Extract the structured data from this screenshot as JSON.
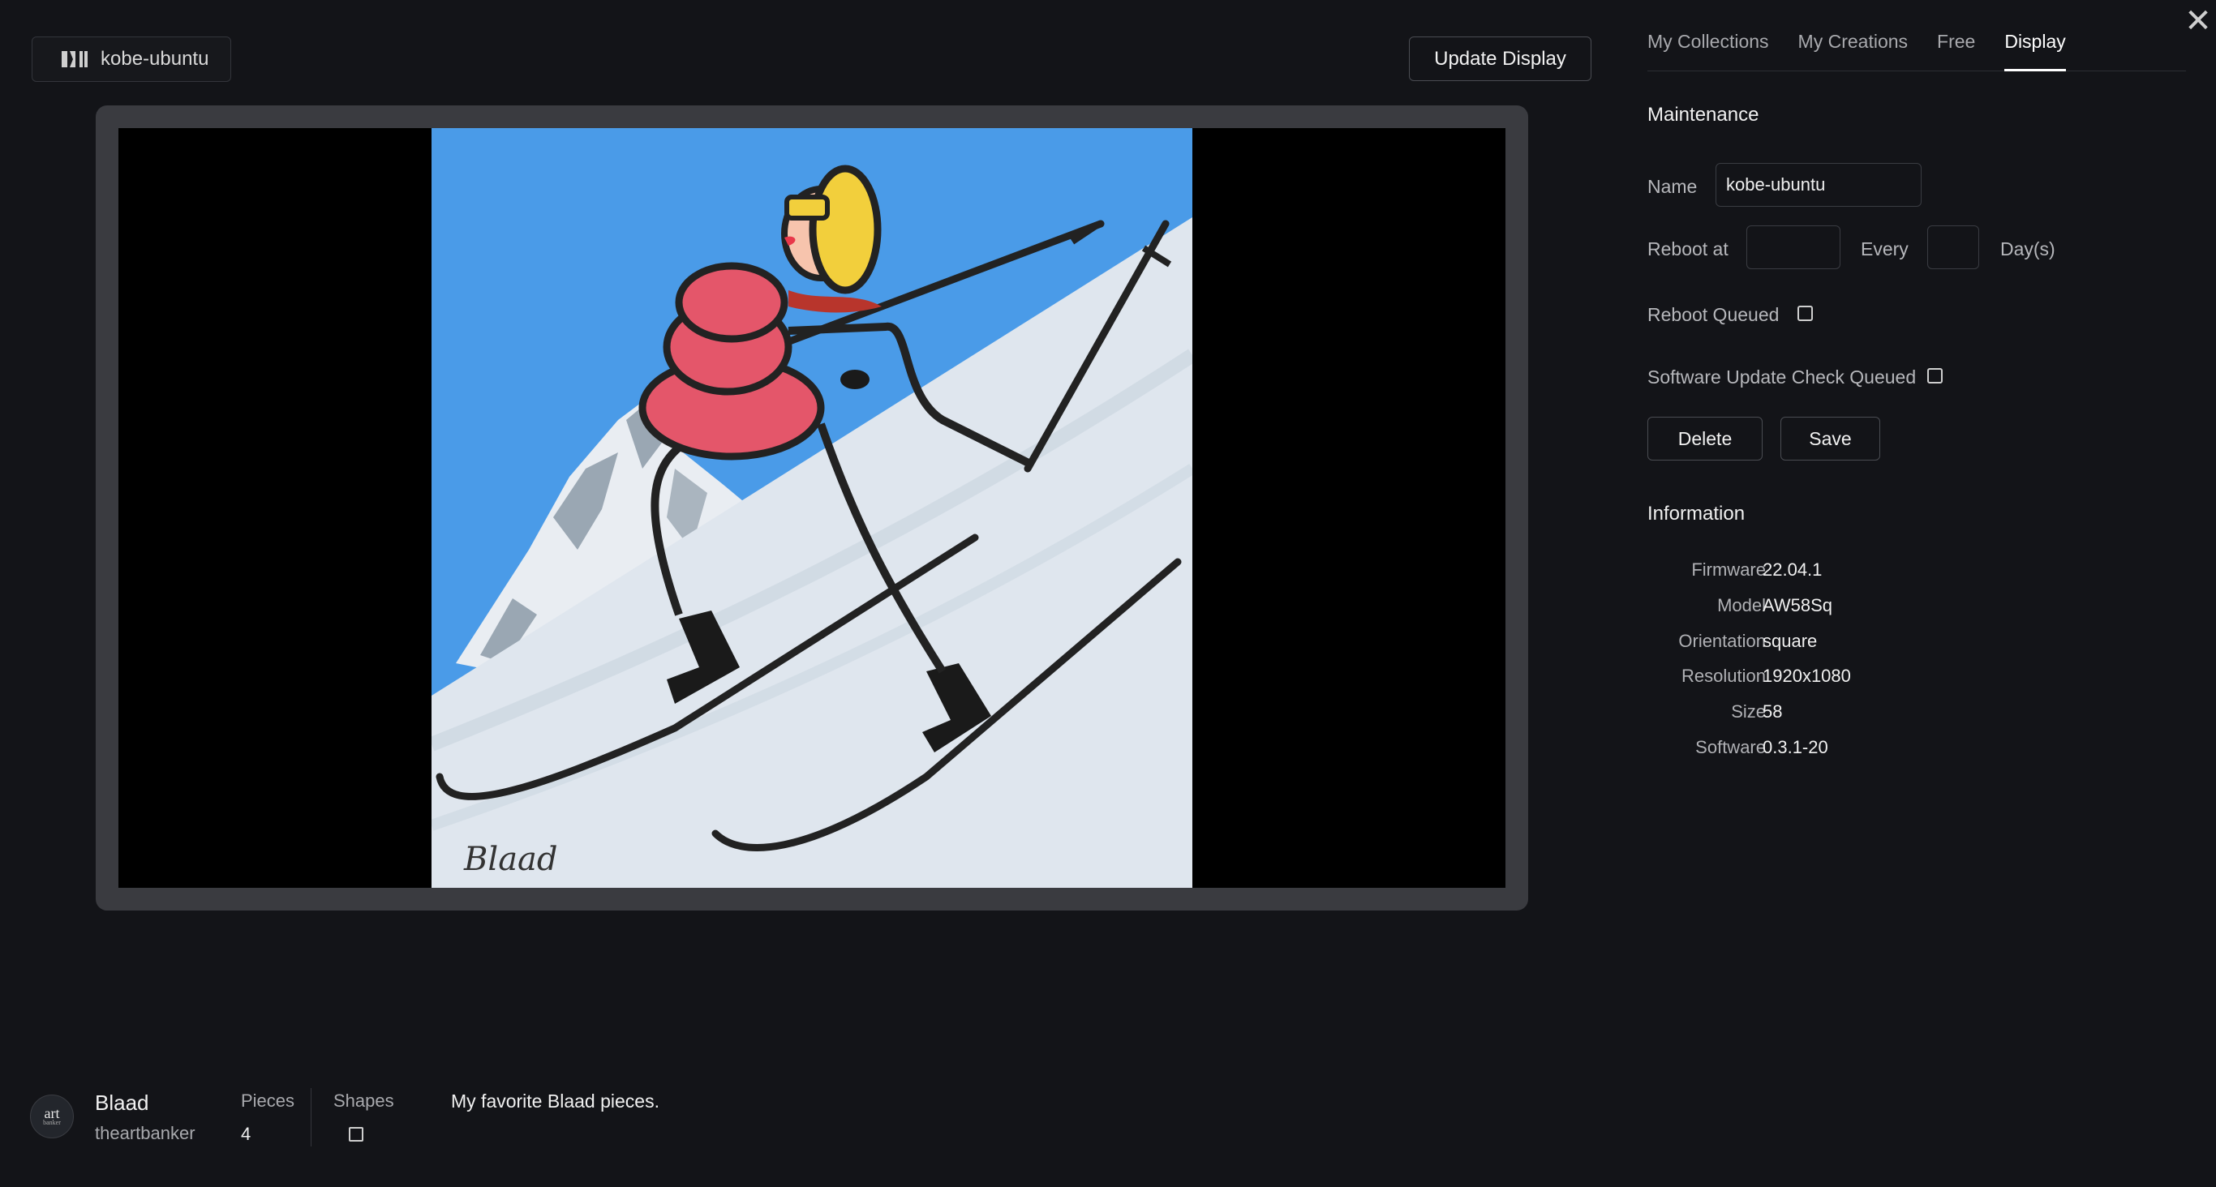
{
  "device": {
    "name": "kobe-ubuntu",
    "icon": "display-brand-icon"
  },
  "header": {
    "update_label": "Update Display",
    "close_icon": "close-icon",
    "close_glyph": "✕"
  },
  "tabs": [
    {
      "label": "My Collections",
      "active": false
    },
    {
      "label": "My Creations",
      "active": false
    },
    {
      "label": "Free",
      "active": false
    },
    {
      "label": "Display",
      "active": true
    }
  ],
  "maintenance": {
    "title": "Maintenance",
    "name_label": "Name",
    "name_value": "kobe-ubuntu",
    "reboot_at_label": "Reboot at",
    "reboot_at_value": "",
    "every_label": "Every",
    "every_value": "",
    "days_label": "Day(s)",
    "reboot_queued_label": "Reboot Queued",
    "reboot_queued_checked": false,
    "software_update_label": "Software Update Check Queued",
    "software_update_checked": false,
    "delete_label": "Delete",
    "save_label": "Save"
  },
  "information": {
    "title": "Information",
    "rows": [
      {
        "key": "Firmware",
        "value": "22.04.1"
      },
      {
        "key": "Model",
        "value": "AW58Sq"
      },
      {
        "key": "Orientation",
        "value": "square"
      },
      {
        "key": "Resolution",
        "value": "1920x1080"
      },
      {
        "key": "Size",
        "value": "58"
      },
      {
        "key": "Software",
        "value": "0.3.1-20"
      }
    ]
  },
  "artwork": {
    "signature": "Blaad",
    "colors": {
      "sky": "#4a9be8",
      "snow": "#dfe6ee",
      "jacket": "#e4566a",
      "hair": "#f2cf3c",
      "scarf": "#b8352c"
    }
  },
  "footer": {
    "avatar_text_1": "art",
    "avatar_text_2": "banker",
    "owner_name": "Blaad",
    "owner_handle": "theartbanker",
    "pieces_label": "Pieces",
    "pieces_value": "4",
    "shapes_label": "Shapes",
    "description": "My favorite Blaad pieces."
  }
}
